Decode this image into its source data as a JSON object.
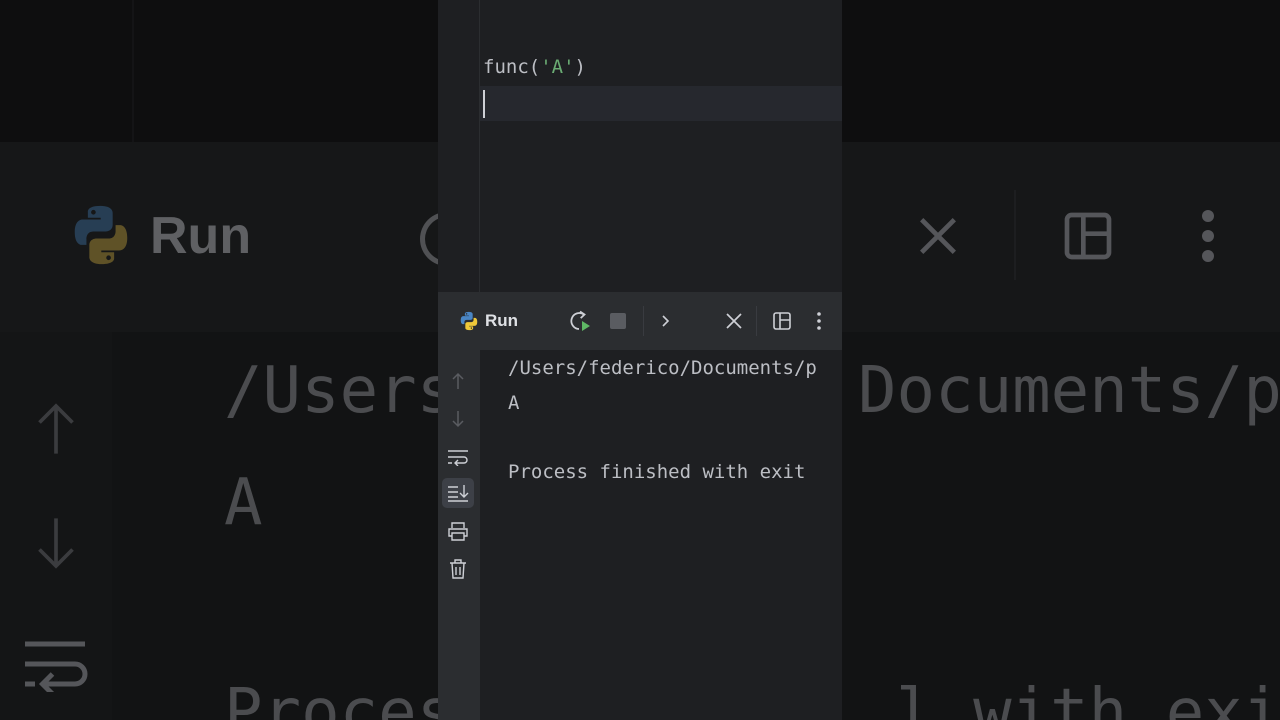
{
  "editor": {
    "code": {
      "func": "func(",
      "arg": "'A'",
      "close": ")"
    }
  },
  "run_tool_window": {
    "title": "Run",
    "toolbar_icons": [
      "python-icon",
      "rerun-icon",
      "stop-icon",
      "chevron-right-icon",
      "close-icon",
      "layout-icon",
      "more-vertical-icon"
    ],
    "side_icons": [
      "arrow-up-icon",
      "arrow-down-icon",
      "soft-wrap-icon",
      "scroll-to-end-icon",
      "print-icon",
      "trash-icon"
    ]
  },
  "console": {
    "lines": [
      "/Users/federico/Documents/p",
      "A",
      "Process finished with exit"
    ]
  },
  "background": {
    "run_label": "Run",
    "path_left": "/Users",
    "path_right": "Documents/p",
    "output_a": "A",
    "process_left": "Proces",
    "process_right": "l with exit"
  },
  "colors": {
    "editor_bg": "#1e1f22",
    "toolwindow_bg": "#2b2d30",
    "text": "#bcbec4",
    "string": "#6aab73"
  }
}
